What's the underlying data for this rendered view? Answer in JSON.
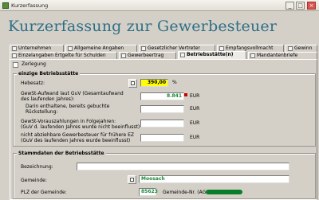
{
  "window": {
    "title": "Kurzerfassung",
    "min": "_",
    "max": "□",
    "close": "×"
  },
  "page_heading": "Kurzerfassung zur Gewerbesteuer",
  "tabs_row1": [
    {
      "label": "Unternehmen",
      "active": false
    },
    {
      "label": "Allgemeine Angaben",
      "active": false
    },
    {
      "label": "Gesetzlicher Vertreter",
      "active": false
    },
    {
      "label": "Empfangsvollmacht",
      "active": false
    },
    {
      "label": "Gewinn",
      "active": false
    }
  ],
  "tabs_row2": [
    {
      "label": "Einzelangaben Ertgelte für Schulden",
      "active": false
    },
    {
      "label": "Gewerbeertrag",
      "active": false
    },
    {
      "label": "Betriebsstätte(n)",
      "active": true
    },
    {
      "label": "Mandantenbriefe",
      "active": false
    }
  ],
  "zerlegung": {
    "label": "Zerlegung",
    "checked": false
  },
  "einzige": {
    "title": "einzige Betriebsstätte",
    "hebesatz_label": "Hebesatz:",
    "hebesatz_value": "390,00",
    "hebesatz_unit": "%",
    "aufwand_label_1": "GewSt-Aufwand laut GuV (Gesamtaufwand",
    "aufwand_label_2": "des laufenden Jahres):",
    "aufwand_value": "8.841",
    "aufwand_unit": "EUR",
    "rueck_label_1": "Darin enthaltene, bereits gebuchte",
    "rueck_label_2": "Rückstellung:",
    "rueck_value": "",
    "rueck_unit": "EUR",
    "voraus_label_1": "GewSt-Vorauszahlungen in Folgejahren:",
    "voraus_label_2": "(GuV d. laufenden Jahres wurde nicht beeinflusst)",
    "voraus_value": "",
    "voraus_unit": "EUR",
    "nicht_label_1": "nicht abziehbare Gewerbesteuer für frühere EZ",
    "nicht_label_2": "(GuV des laufenden Jahres wurde beeinflusst)",
    "nicht_value": "",
    "nicht_unit": "EUR"
  },
  "stamm": {
    "title": "Stammdaten der Betriebsstätte",
    "bezeichnung_label": "Bezeichnung:",
    "bezeichnung_value": "",
    "gemeinde_label": "Gemeinde:",
    "gemeinde_value": "Moosach",
    "plz_label": "PLZ der Gemeinde:",
    "plz_value": "85623",
    "ags_label": "Gemeinde-Nr. (AGS):"
  },
  "colors": {
    "heading": "#2f6f86",
    "highlight": "#ffff00",
    "gemeinde_text": "#1a8a3a"
  }
}
